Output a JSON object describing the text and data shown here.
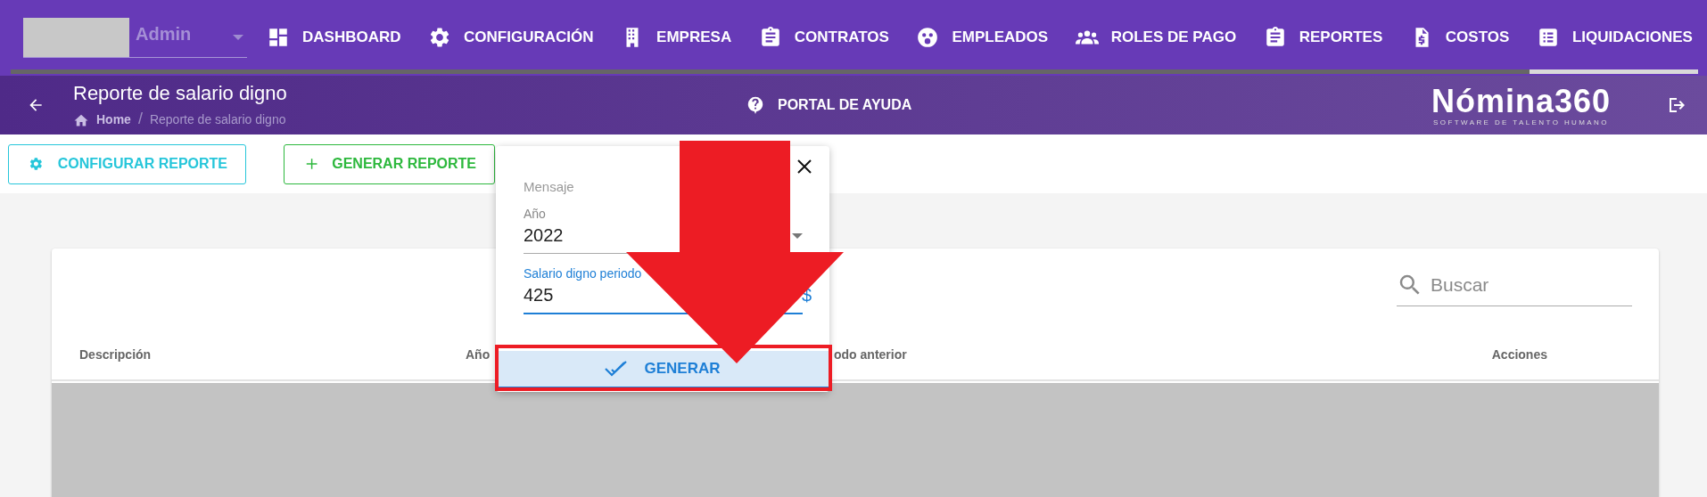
{
  "user_menu": {
    "label": "Admin"
  },
  "nav": [
    {
      "label": "DASHBOARD"
    },
    {
      "label": "CONFIGURACIÓN"
    },
    {
      "label": "EMPRESA"
    },
    {
      "label": "CONTRATOS"
    },
    {
      "label": "EMPLEADOS"
    },
    {
      "label": "ROLES DE PAGO"
    },
    {
      "label": "REPORTES"
    },
    {
      "label": "COSTOS"
    },
    {
      "label": "LIQUIDACIONES"
    }
  ],
  "header": {
    "title": "Reporte de salario digno",
    "breadcrumb": [
      "Home",
      "Reporte de salario digno"
    ],
    "breadcrumb_separator": "/",
    "help_link": "PORTAL DE AYUDA",
    "logo": {
      "name": "Nómina360",
      "tagline": "SOFTWARE DE TALENTO HUMANO"
    }
  },
  "actions": [
    {
      "label": "CONFIGURAR REPORTE",
      "kind": "config"
    },
    {
      "label": "GENERAR REPORTE",
      "kind": "add"
    }
  ],
  "table": {
    "search": {
      "placeholder": "Buscar"
    },
    "columns": [
      "Descripción",
      "Año",
      "odo anterior",
      "Acciones"
    ]
  },
  "dialog": {
    "title": "Mensaje",
    "fields": [
      {
        "kind": "select",
        "label": "Año",
        "value": "2022",
        "focused": false
      },
      {
        "kind": "input",
        "label": "Salario digno periodo",
        "value": "425",
        "suffix": "$",
        "focused": true
      }
    ],
    "button": "GENERAR"
  }
}
